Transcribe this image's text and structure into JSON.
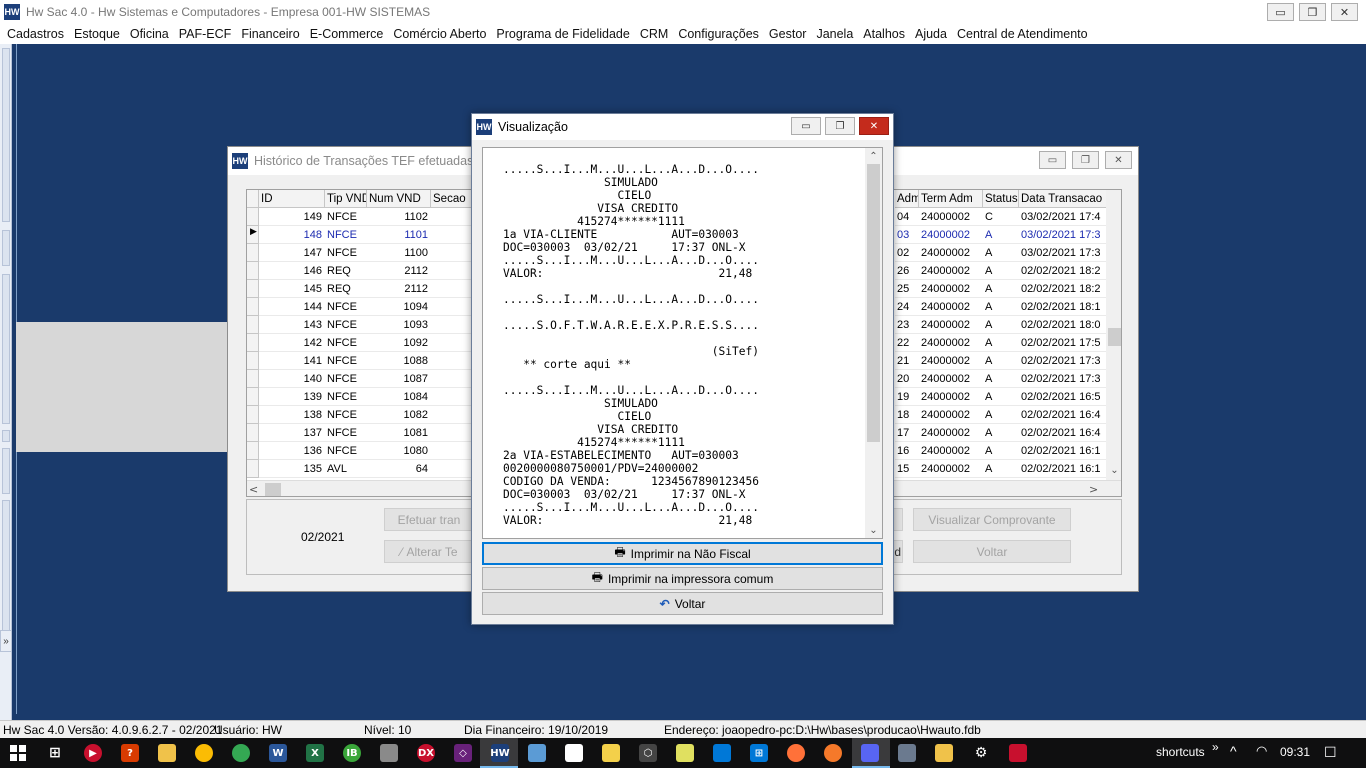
{
  "app": {
    "title": "Hw Sac 4.0 - Hw Sistemas e Computadores - Empresa 001-HW SISTEMAS",
    "logo_text": "HW"
  },
  "window_controls": {
    "minimize": "▭",
    "restore": "❐",
    "close": "✕"
  },
  "menu": [
    "Cadastros",
    "Estoque",
    "Oficina",
    "PAF-ECF",
    "Financeiro",
    "E-Commerce",
    "Comércio Aberto",
    "Programa de Fidelidade",
    "CRM",
    "Configurações",
    "Gestor",
    "Janela",
    "Atalhos",
    "Ajuda",
    "Central de Atendimento"
  ],
  "history_window": {
    "title": "Histórico de Transações TEF efetuadas pel",
    "columns_left": [
      "ID",
      "Tip VND",
      "Num VND",
      "Secao"
    ],
    "columns_right": [
      "Adm",
      "Term Adm",
      "Status",
      "Data Transacao"
    ],
    "rows": [
      {
        "id": "149",
        "tip": "NFCE",
        "num": "1102",
        "adm": "04",
        "term": "24000002",
        "status": "C",
        "data": "03/02/2021 17:4"
      },
      {
        "id": "148",
        "tip": "NFCE",
        "num": "1101",
        "adm": "03",
        "term": "24000002",
        "status": "A",
        "data": "03/02/2021 17:3",
        "selected": true
      },
      {
        "id": "147",
        "tip": "NFCE",
        "num": "1100",
        "adm": "02",
        "term": "24000002",
        "status": "A",
        "data": "03/02/2021 17:3"
      },
      {
        "id": "146",
        "tip": "REQ",
        "num": "2112",
        "adm": "26",
        "term": "24000002",
        "status": "A",
        "data": "02/02/2021 18:2"
      },
      {
        "id": "145",
        "tip": "REQ",
        "num": "2112",
        "adm": "25",
        "term": "24000002",
        "status": "A",
        "data": "02/02/2021 18:2"
      },
      {
        "id": "144",
        "tip": "NFCE",
        "num": "1094",
        "adm": "24",
        "term": "24000002",
        "status": "A",
        "data": "02/02/2021 18:1"
      },
      {
        "id": "143",
        "tip": "NFCE",
        "num": "1093",
        "adm": "23",
        "term": "24000002",
        "status": "A",
        "data": "02/02/2021 18:0"
      },
      {
        "id": "142",
        "tip": "NFCE",
        "num": "1092",
        "adm": "22",
        "term": "24000002",
        "status": "A",
        "data": "02/02/2021 17:5"
      },
      {
        "id": "141",
        "tip": "NFCE",
        "num": "1088",
        "adm": "21",
        "term": "24000002",
        "status": "A",
        "data": "02/02/2021 17:3"
      },
      {
        "id": "140",
        "tip": "NFCE",
        "num": "1087",
        "adm": "20",
        "term": "24000002",
        "status": "A",
        "data": "02/02/2021 17:3"
      },
      {
        "id": "139",
        "tip": "NFCE",
        "num": "1084",
        "adm": "19",
        "term": "24000002",
        "status": "A",
        "data": "02/02/2021 16:5"
      },
      {
        "id": "138",
        "tip": "NFCE",
        "num": "1082",
        "adm": "18",
        "term": "24000002",
        "status": "A",
        "data": "02/02/2021 16:4"
      },
      {
        "id": "137",
        "tip": "NFCE",
        "num": "1081",
        "adm": "17",
        "term": "24000002",
        "status": "A",
        "data": "02/02/2021 16:4"
      },
      {
        "id": "136",
        "tip": "NFCE",
        "num": "1080",
        "adm": "16",
        "term": "24000002",
        "status": "A",
        "data": "02/02/2021 16:1"
      },
      {
        "id": "135",
        "tip": "AVL",
        "num": "64",
        "adm": "15",
        "term": "24000002",
        "status": "A",
        "data": "02/02/2021 16:1"
      }
    ],
    "period": "02/2021",
    "buttons": {
      "efetuar": "Efetuar tran",
      "alterar": "Alterar Te",
      "visualizar": "Visualizar Comprovante",
      "voltar": "Voltar",
      "partial_d": "d"
    }
  },
  "viz_dialog": {
    "title": "Visualização",
    "receipt": ".....S...I...M...U...L...A...D...O....\n               SIMULADO\n                 CIELO\n              VISA CREDITO\n           415274******1111\n1a VIA-CLIENTE           AUT=030003\nDOC=030003  03/02/21     17:37 ONL-X\n.....S...I...M...U...L...A...D...O....\nVALOR:                          21,48\n\n.....S...I...M...U...L...A...D...O....\n\n.....S.O.F.T.W.A.R.E.E.X.P.R.E.S.S....\n\n                               (SiTef)\n   ** corte aqui **\n\n.....S...I...M...U...L...A...D...O....\n               SIMULADO\n                 CIELO\n              VISA CREDITO\n           415274******1111\n2a VIA-ESTABELECIMENTO   AUT=030003\n0020000080750001/PDV=24000002\nCODIGO DA VENDA:      1234567890123456\nDOC=030003  03/02/21     17:37 ONL-X\n.....S...I...M...U...L...A...D...O....\nVALOR:                          21,48",
    "btn_nao_fiscal": "Imprimir na Não Fiscal",
    "btn_comum": "Imprimir na impressora comum",
    "btn_voltar": "Voltar"
  },
  "statusbar": {
    "version": "Hw Sac 4.0 Versão: 4.0.9.6.2.7 - 02/2021",
    "user": "Usuário: HW",
    "level": "Nível: 10",
    "fin_day": "Dia Financeiro: 19/10/2019",
    "address": "Endereço: joaopedro-pc:D:\\Hw\\bases\\producao\\Hwauto.fdb"
  },
  "taskbar": {
    "tray_label": "shortcuts",
    "tray_chevron": "»",
    "clock": "09:31"
  }
}
